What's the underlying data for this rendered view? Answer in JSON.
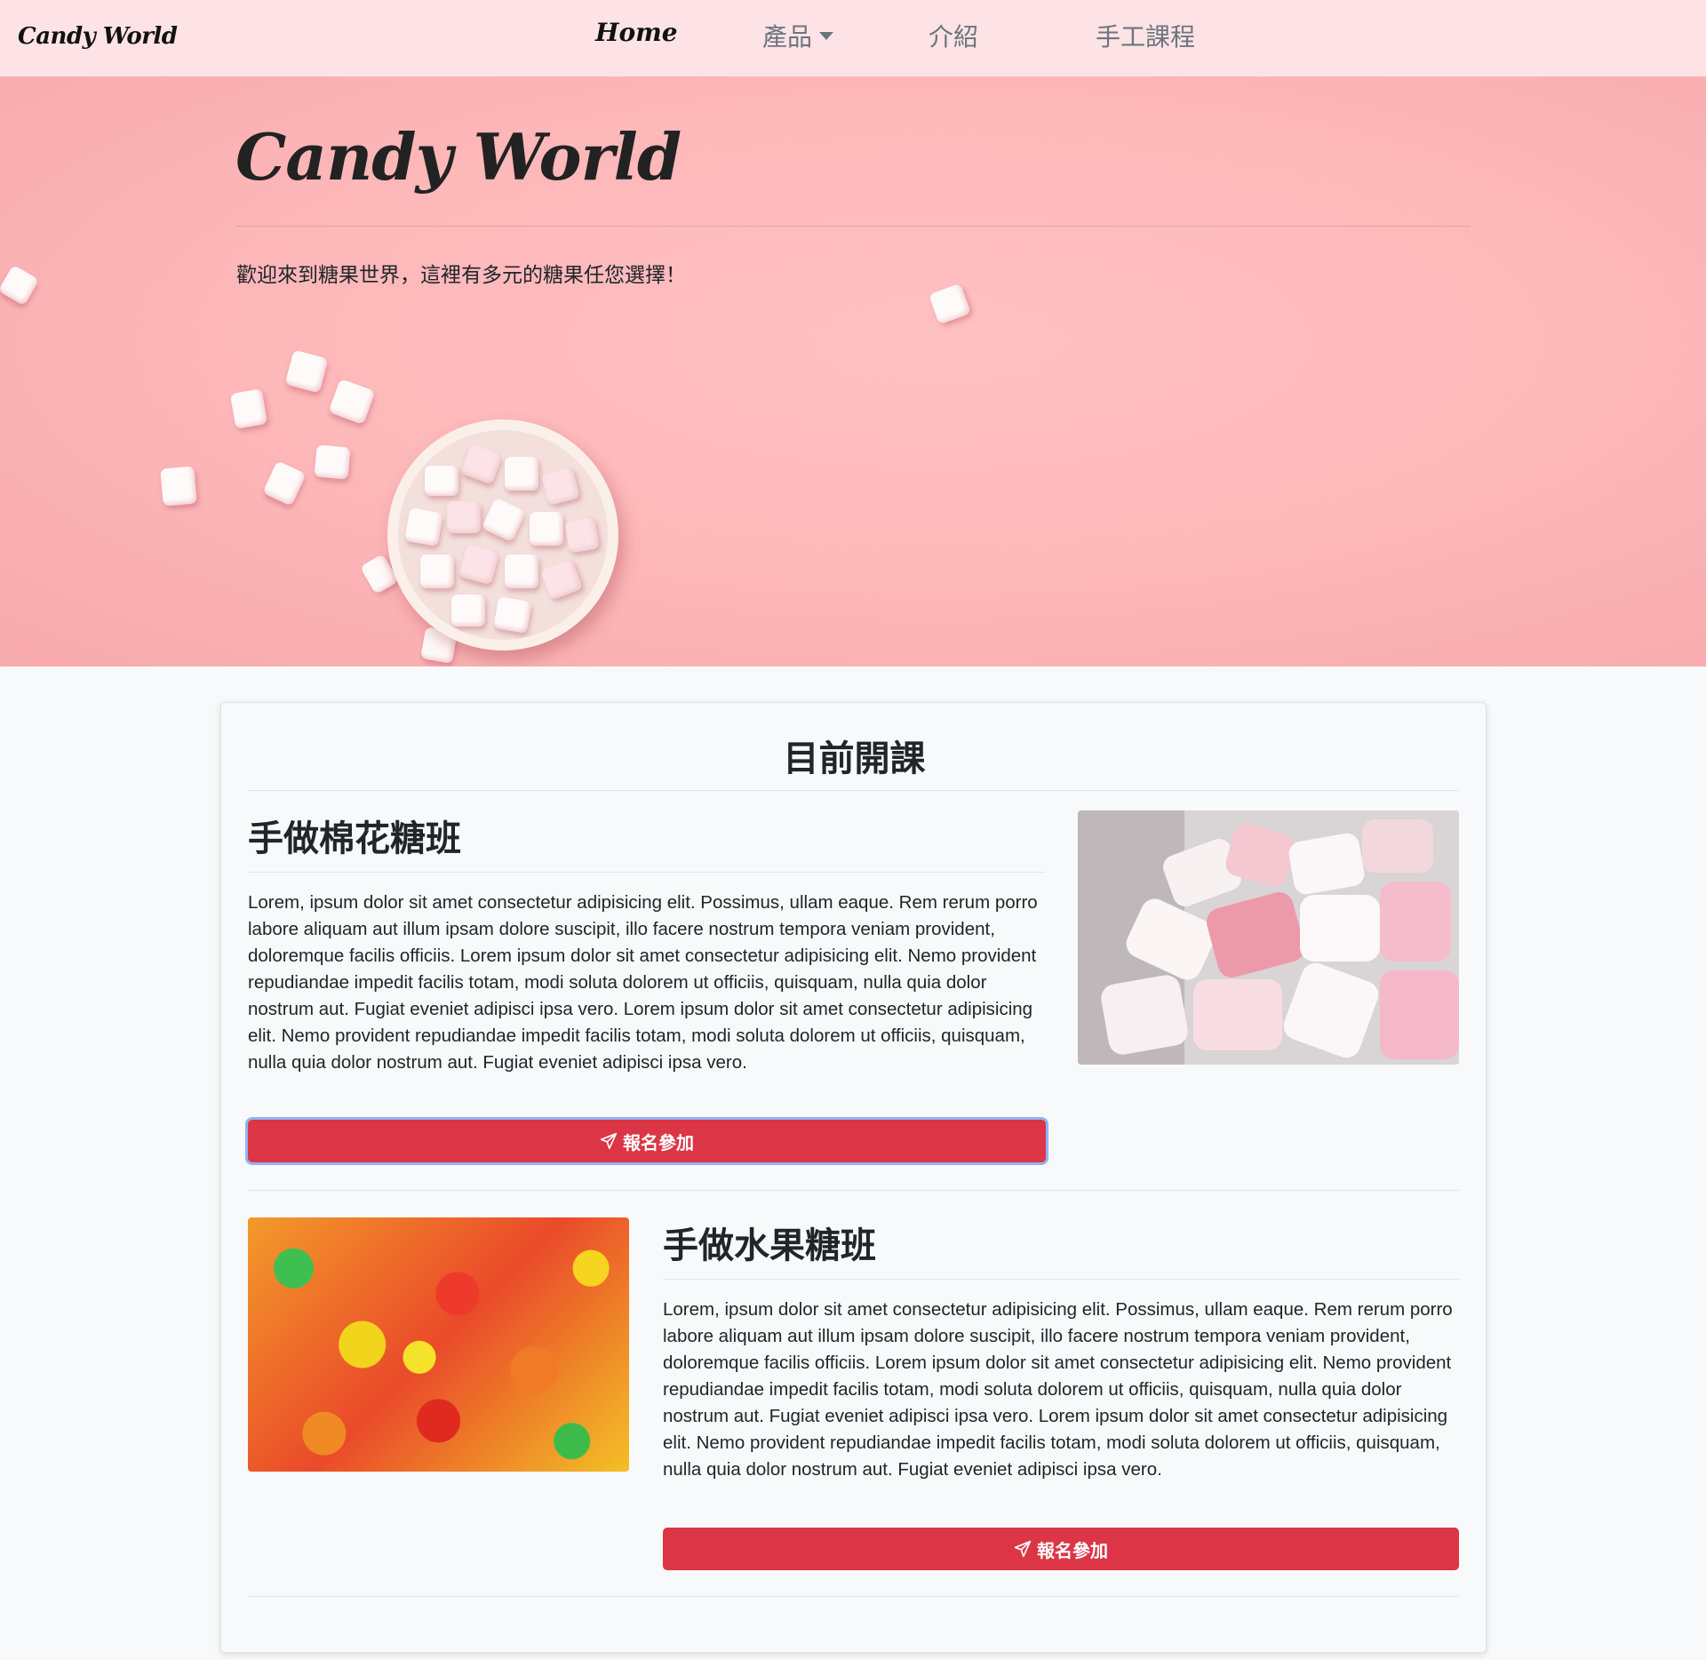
{
  "navbar": {
    "brand": "Candy World",
    "links": [
      {
        "label": "Home"
      },
      {
        "label": "產品"
      },
      {
        "label": "介紹"
      },
      {
        "label": "手工課程"
      }
    ]
  },
  "hero": {
    "title": "Candy World",
    "lead": "歡迎來到糖果世界，這裡有多元的糖果任您選擇！"
  },
  "courses_section": {
    "title": "目前開課",
    "courses": [
      {
        "title": "手做棉花糖班",
        "description": "Lorem, ipsum dolor sit amet consectetur adipisicing elit. Possimus, ullam eaque. Rem rerum porro labore aliquam aut illum ipsam dolore suscipit, illo facere nostrum tempora veniam provident, doloremque facilis officiis. Lorem ipsum dolor sit amet consectetur adipisicing elit. Nemo provident repudiandae impedit facilis totam, modi soluta dolorem ut officiis, quisquam, nulla quia dolor nostrum aut. Fugiat eveniet adipisci ipsa vero. Lorem ipsum dolor sit amet consectetur adipisicing elit. Nemo provident repudiandae impedit facilis totam, modi soluta dolorem ut officiis, quisquam, nulla quia dolor nostrum aut. Fugiat eveniet adipisci ipsa vero.",
        "button_label": "報名參加"
      },
      {
        "title": "手做水果糖班",
        "description": "Lorem, ipsum dolor sit amet consectetur adipisicing elit. Possimus, ullam eaque. Rem rerum porro labore aliquam aut illum ipsam dolore suscipit, illo facere nostrum tempora veniam provident, doloremque facilis officiis. Lorem ipsum dolor sit amet consectetur adipisicing elit. Nemo provident repudiandae impedit facilis totam, modi soluta dolorem ut officiis, quisquam, nulla quia dolor nostrum aut. Fugiat eveniet adipisci ipsa vero. Lorem ipsum dolor sit amet consectetur adipisicing elit. Nemo provident repudiandae impedit facilis totam, modi soluta dolorem ut officiis, quisquam, nulla quia dolor nostrum aut. Fugiat eveniet adipisci ipsa vero.",
        "button_label": "報名參加"
      }
    ]
  },
  "icons": {
    "button_icon": "paper-plane-icon",
    "dropdown_icon": "caret-down-icon"
  },
  "colors": {
    "navbar_bg": "#fde3e5",
    "hero_bg": "#fdb7b9",
    "button_bg": "#dc3545",
    "page_bg": "#f8f9fa"
  }
}
